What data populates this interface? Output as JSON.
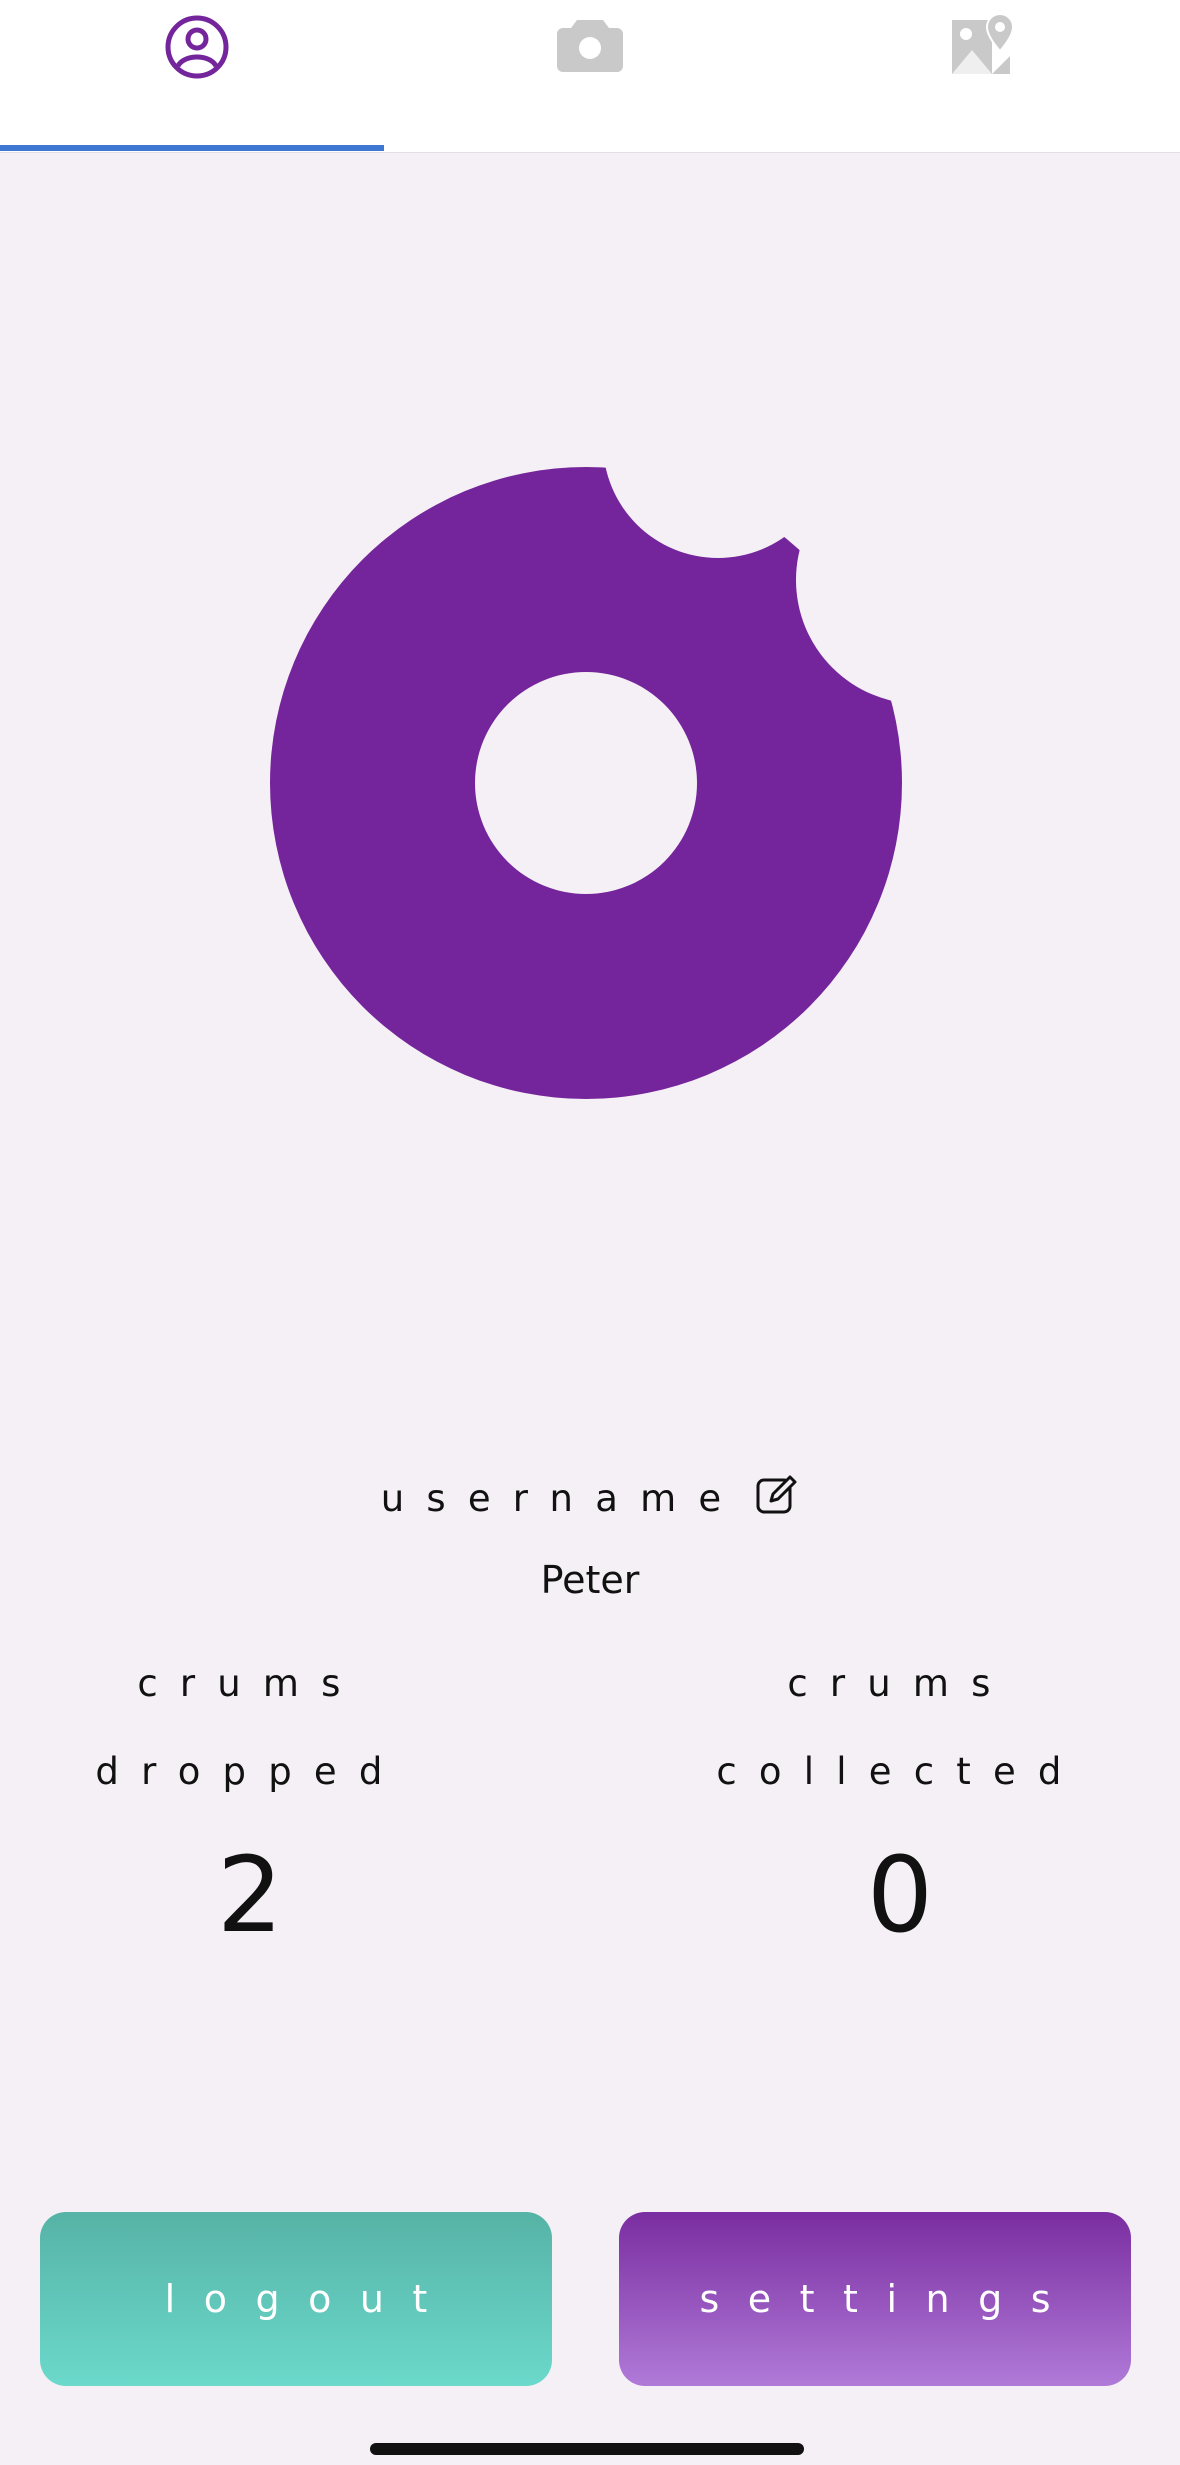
{
  "tabs": [
    {
      "name": "profile",
      "icon": "profile-icon",
      "active": true
    },
    {
      "name": "camera",
      "icon": "camera-icon",
      "active": false
    },
    {
      "name": "map",
      "icon": "map-icon",
      "active": false
    }
  ],
  "colors": {
    "accent": "#75259b",
    "tab_indicator": "#3f78d2",
    "logout_button": "#5fc8bb",
    "settings_button": "#8e47b8",
    "inactive_icon": "#c9c9c9"
  },
  "profile": {
    "avatar": "donut-logo",
    "username_label": "username",
    "username_value": "Peter",
    "edit_icon": "edit-icon"
  },
  "stats": {
    "dropped": {
      "line1": "crums",
      "line2": "dropped",
      "value": "2"
    },
    "collected": {
      "line1": "crums",
      "line2": "collected",
      "value": "0"
    }
  },
  "buttons": {
    "logout_label": "logout",
    "settings_label": "settings"
  }
}
